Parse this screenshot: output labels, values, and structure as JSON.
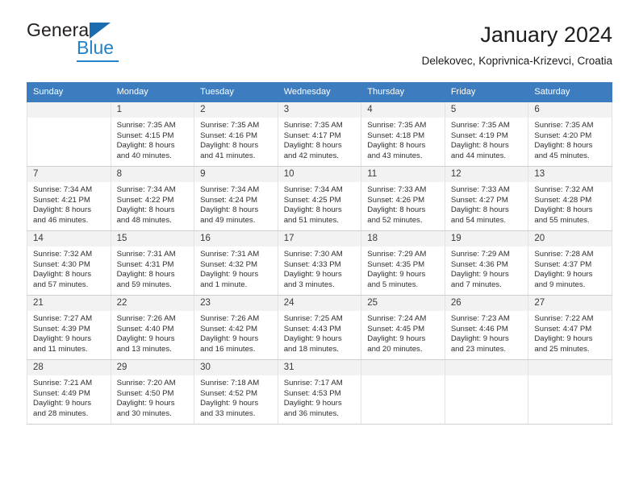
{
  "logo": {
    "word1": "General",
    "word2": "Blue",
    "triangle_color": "#1a6bb0",
    "blue_color": "#2382c8"
  },
  "header": {
    "title": "January 2024",
    "subtitle": "Delekovec, Koprivnica-Krizevci, Croatia"
  },
  "calendar": {
    "header_bg": "#3d7dbf",
    "weekdays": [
      "Sunday",
      "Monday",
      "Tuesday",
      "Wednesday",
      "Thursday",
      "Friday",
      "Saturday"
    ],
    "weeks": [
      [
        {
          "day": ""
        },
        {
          "day": "1",
          "sunrise": "Sunrise: 7:35 AM",
          "sunset": "Sunset: 4:15 PM",
          "daylight1": "Daylight: 8 hours",
          "daylight2": "and 40 minutes."
        },
        {
          "day": "2",
          "sunrise": "Sunrise: 7:35 AM",
          "sunset": "Sunset: 4:16 PM",
          "daylight1": "Daylight: 8 hours",
          "daylight2": "and 41 minutes."
        },
        {
          "day": "3",
          "sunrise": "Sunrise: 7:35 AM",
          "sunset": "Sunset: 4:17 PM",
          "daylight1": "Daylight: 8 hours",
          "daylight2": "and 42 minutes."
        },
        {
          "day": "4",
          "sunrise": "Sunrise: 7:35 AM",
          "sunset": "Sunset: 4:18 PM",
          "daylight1": "Daylight: 8 hours",
          "daylight2": "and 43 minutes."
        },
        {
          "day": "5",
          "sunrise": "Sunrise: 7:35 AM",
          "sunset": "Sunset: 4:19 PM",
          "daylight1": "Daylight: 8 hours",
          "daylight2": "and 44 minutes."
        },
        {
          "day": "6",
          "sunrise": "Sunrise: 7:35 AM",
          "sunset": "Sunset: 4:20 PM",
          "daylight1": "Daylight: 8 hours",
          "daylight2": "and 45 minutes."
        }
      ],
      [
        {
          "day": "7",
          "sunrise": "Sunrise: 7:34 AM",
          "sunset": "Sunset: 4:21 PM",
          "daylight1": "Daylight: 8 hours",
          "daylight2": "and 46 minutes."
        },
        {
          "day": "8",
          "sunrise": "Sunrise: 7:34 AM",
          "sunset": "Sunset: 4:22 PM",
          "daylight1": "Daylight: 8 hours",
          "daylight2": "and 48 minutes."
        },
        {
          "day": "9",
          "sunrise": "Sunrise: 7:34 AM",
          "sunset": "Sunset: 4:24 PM",
          "daylight1": "Daylight: 8 hours",
          "daylight2": "and 49 minutes."
        },
        {
          "day": "10",
          "sunrise": "Sunrise: 7:34 AM",
          "sunset": "Sunset: 4:25 PM",
          "daylight1": "Daylight: 8 hours",
          "daylight2": "and 51 minutes."
        },
        {
          "day": "11",
          "sunrise": "Sunrise: 7:33 AM",
          "sunset": "Sunset: 4:26 PM",
          "daylight1": "Daylight: 8 hours",
          "daylight2": "and 52 minutes."
        },
        {
          "day": "12",
          "sunrise": "Sunrise: 7:33 AM",
          "sunset": "Sunset: 4:27 PM",
          "daylight1": "Daylight: 8 hours",
          "daylight2": "and 54 minutes."
        },
        {
          "day": "13",
          "sunrise": "Sunrise: 7:32 AM",
          "sunset": "Sunset: 4:28 PM",
          "daylight1": "Daylight: 8 hours",
          "daylight2": "and 55 minutes."
        }
      ],
      [
        {
          "day": "14",
          "sunrise": "Sunrise: 7:32 AM",
          "sunset": "Sunset: 4:30 PM",
          "daylight1": "Daylight: 8 hours",
          "daylight2": "and 57 minutes."
        },
        {
          "day": "15",
          "sunrise": "Sunrise: 7:31 AM",
          "sunset": "Sunset: 4:31 PM",
          "daylight1": "Daylight: 8 hours",
          "daylight2": "and 59 minutes."
        },
        {
          "day": "16",
          "sunrise": "Sunrise: 7:31 AM",
          "sunset": "Sunset: 4:32 PM",
          "daylight1": "Daylight: 9 hours",
          "daylight2": "and 1 minute."
        },
        {
          "day": "17",
          "sunrise": "Sunrise: 7:30 AM",
          "sunset": "Sunset: 4:33 PM",
          "daylight1": "Daylight: 9 hours",
          "daylight2": "and 3 minutes."
        },
        {
          "day": "18",
          "sunrise": "Sunrise: 7:29 AM",
          "sunset": "Sunset: 4:35 PM",
          "daylight1": "Daylight: 9 hours",
          "daylight2": "and 5 minutes."
        },
        {
          "day": "19",
          "sunrise": "Sunrise: 7:29 AM",
          "sunset": "Sunset: 4:36 PM",
          "daylight1": "Daylight: 9 hours",
          "daylight2": "and 7 minutes."
        },
        {
          "day": "20",
          "sunrise": "Sunrise: 7:28 AM",
          "sunset": "Sunset: 4:37 PM",
          "daylight1": "Daylight: 9 hours",
          "daylight2": "and 9 minutes."
        }
      ],
      [
        {
          "day": "21",
          "sunrise": "Sunrise: 7:27 AM",
          "sunset": "Sunset: 4:39 PM",
          "daylight1": "Daylight: 9 hours",
          "daylight2": "and 11 minutes."
        },
        {
          "day": "22",
          "sunrise": "Sunrise: 7:26 AM",
          "sunset": "Sunset: 4:40 PM",
          "daylight1": "Daylight: 9 hours",
          "daylight2": "and 13 minutes."
        },
        {
          "day": "23",
          "sunrise": "Sunrise: 7:26 AM",
          "sunset": "Sunset: 4:42 PM",
          "daylight1": "Daylight: 9 hours",
          "daylight2": "and 16 minutes."
        },
        {
          "day": "24",
          "sunrise": "Sunrise: 7:25 AM",
          "sunset": "Sunset: 4:43 PM",
          "daylight1": "Daylight: 9 hours",
          "daylight2": "and 18 minutes."
        },
        {
          "day": "25",
          "sunrise": "Sunrise: 7:24 AM",
          "sunset": "Sunset: 4:45 PM",
          "daylight1": "Daylight: 9 hours",
          "daylight2": "and 20 minutes."
        },
        {
          "day": "26",
          "sunrise": "Sunrise: 7:23 AM",
          "sunset": "Sunset: 4:46 PM",
          "daylight1": "Daylight: 9 hours",
          "daylight2": "and 23 minutes."
        },
        {
          "day": "27",
          "sunrise": "Sunrise: 7:22 AM",
          "sunset": "Sunset: 4:47 PM",
          "daylight1": "Daylight: 9 hours",
          "daylight2": "and 25 minutes."
        }
      ],
      [
        {
          "day": "28",
          "sunrise": "Sunrise: 7:21 AM",
          "sunset": "Sunset: 4:49 PM",
          "daylight1": "Daylight: 9 hours",
          "daylight2": "and 28 minutes."
        },
        {
          "day": "29",
          "sunrise": "Sunrise: 7:20 AM",
          "sunset": "Sunset: 4:50 PM",
          "daylight1": "Daylight: 9 hours",
          "daylight2": "and 30 minutes."
        },
        {
          "day": "30",
          "sunrise": "Sunrise: 7:18 AM",
          "sunset": "Sunset: 4:52 PM",
          "daylight1": "Daylight: 9 hours",
          "daylight2": "and 33 minutes."
        },
        {
          "day": "31",
          "sunrise": "Sunrise: 7:17 AM",
          "sunset": "Sunset: 4:53 PM",
          "daylight1": "Daylight: 9 hours",
          "daylight2": "and 36 minutes."
        },
        {
          "day": ""
        },
        {
          "day": ""
        },
        {
          "day": ""
        }
      ]
    ]
  }
}
